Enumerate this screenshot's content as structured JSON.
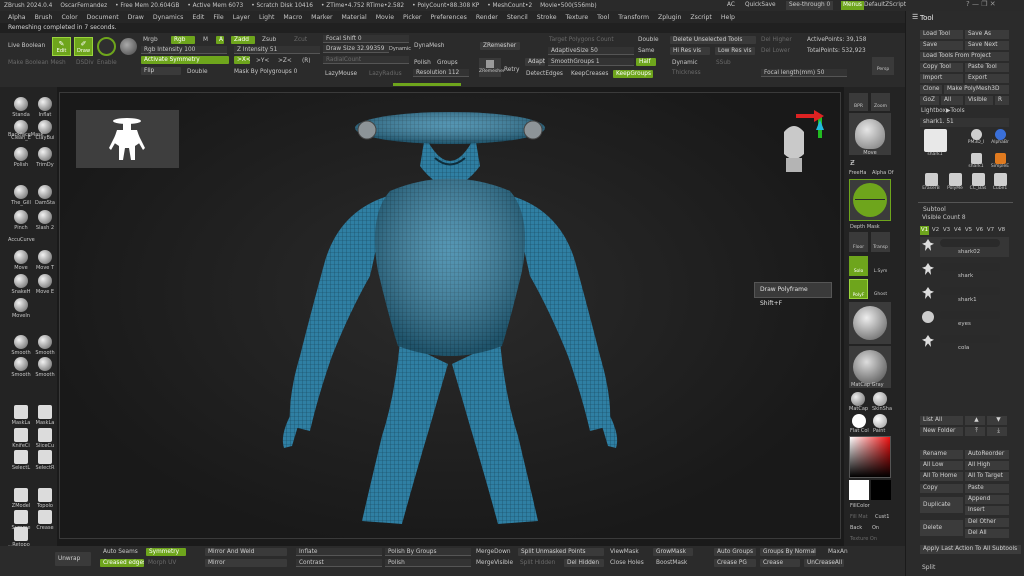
{
  "titlebar": {
    "app": "ZBrush 2024.0.4",
    "user": "OscarFernandez",
    "free_mem": "• Free Mem 20.604GB",
    "active_mem": "• Active Mem 6073",
    "scratch": "• Scratch Disk 10416",
    "ztime": "• ZTime•4.752 RTime•2.582",
    "polycount": "• PolyCount•88.308 KP",
    "meshcount": "• MeshCount•2",
    "movie": "Movie•500(556mb)",
    "ac": "AC",
    "quicksave": "QuickSave",
    "seethrough": "See-through",
    "seethrough_val": "0",
    "menus": "Menus",
    "script": "DefaultZScript"
  },
  "menu": [
    "Alpha",
    "Brush",
    "Color",
    "Document",
    "Draw",
    "Dynamics",
    "Edit",
    "File",
    "Layer",
    "Light",
    "Macro",
    "Marker",
    "Material",
    "Movie",
    "Picker",
    "Preferences",
    "Render",
    "Stencil",
    "Stroke",
    "Texture",
    "Tool",
    "Transform",
    "Zplugin",
    "Zscript",
    "Help"
  ],
  "notice": "Remeshing completed in 7 seconds.",
  "top": {
    "live_boolean": "Live Boolean",
    "make_boolean_mesh": "Make Boolean Mesh",
    "dsdiv": "DSDiv",
    "enable": "Enable",
    "edit": "Edit",
    "draw": "Draw",
    "mrgb": "Mrgb",
    "rgb": "Rgb",
    "m": "M",
    "zadd": "Zadd",
    "zsub": "Zsub",
    "zcut": "Zcut",
    "a": "A",
    "rgb_intensity": "Rgb Intensity 100",
    "z_intensity": "Z Intensity 51",
    "activate_symmetry": "Activate Symmetry",
    "x_axis": ">X<",
    "y_axis": ">Y<",
    "z_axis": ">Z<",
    "r": "(R)",
    "flip": "Flip",
    "double": "Double",
    "mask_by_polygroups": "Mask By Polygroups 0",
    "focal_shift": "Focal Shift 0",
    "draw_size": "Draw Size 32.99359",
    "dynamic": "Dynamic",
    "radial_count": "RadialCount",
    "lazymouse": "LazyMouse",
    "lazyradius": "LazyRadius",
    "dynamesh": "DynaMesh",
    "polish": "Polish",
    "groups": "Groups",
    "resolution": "Resolution 112",
    "zremesher": "ZRemesher",
    "zremesher_icon": "ZRemesher",
    "retry": "Retry",
    "target_polygons": "Target Polygons Count",
    "adaptive": "Adapt",
    "adaptive_size": "AdaptiveSize 50",
    "smooth_groups": "SmoothGroups 1",
    "detect_edges": "DetectEdges",
    "keep_creases": "KeepCreases",
    "keep_groups": "KeepGroups",
    "double2": "Double",
    "same": "Same",
    "half": "Half",
    "delete_unselected": "Delete Unselected Tools",
    "hi_res_vis": "Hi Res vis",
    "low_res_vis": "Low Res vis",
    "dynamic2": "Dynamic",
    "thickness": "Thickness",
    "del_higher": "Del Higher",
    "del_lower": "Del Lower",
    "active_points": "ActivePoints: 39,158",
    "total_points": "TotalPoints: 532,923",
    "smooth_subdiv": "SSub",
    "focal_length": "Focal length(mm) 50",
    "persp": "Persp"
  },
  "left": {
    "standard": "Standa",
    "inflat": "Inflat",
    "clean": "Clean_E",
    "claybuild": "ClayBui",
    "backface": "BackfaceMask",
    "polish": "Polish",
    "trimdy": "TrimDy",
    "gill": "The_Gill",
    "damstd": "DamSta",
    "pinch": "Pinch",
    "slash": "Slash 2",
    "accucurve": "AccuCurve",
    "move": "Move",
    "movet": "Move T",
    "snakeh": "SnakeH",
    "movee": "Move E",
    "movein": "MoveIn",
    "smooth1": "Smooth",
    "smooth2": "Smooth",
    "smooth3": "Smooth",
    "smooth4": "Smooth",
    "masklasso": "MaskLa",
    "masklasso2": "MaskLa",
    "knife": "KnifeCi",
    "slicecurve": "SliceCu",
    "selectlasso": "SelectL",
    "selectrect": "SelectR",
    "zmodel": "ZModel",
    "topology": "Topolo",
    "symmetry": "Symme",
    "crease": "Crease",
    "retopo": "Retopo",
    "flatten": "Flatten",
    "uvflatten": "UVFlatten"
  },
  "right": {
    "bpr": "BPR",
    "zoom": "Zoom",
    "move": "Move",
    "freehand": "FreeHa",
    "alpha": "Alpha Of",
    "depth_mask": "Depth Mask",
    "floor": "Floor",
    "transp": "Transp",
    "solo": "Solo",
    "lsym": "L.Sym",
    "dynamic": "Dynamic",
    "ghost": "Ghost",
    "polyf": "PolyF",
    "matcap_gray": "MatCap Gray",
    "matcap": "MatCap",
    "skinshade": "SkinSha",
    "flat_color": "Flat Col",
    "paint": "Paint",
    "fill_color": "FillColor",
    "fill_mat": "Fill Mat",
    "cust": "Cust1",
    "back": "Back",
    "on": "On",
    "texture_on": "Texture On"
  },
  "tooltip": "Draw Polyframe Shift+F",
  "panel": {
    "title": "Tool",
    "load_tool": "Load Tool",
    "save_as": "Save As",
    "save": "Save",
    "save_next": "Save Next",
    "load_tools_from_project": "Load Tools From Project",
    "copy_tool": "Copy Tool",
    "paste_tool": "Paste Tool",
    "import": "Import",
    "export": "Export",
    "clone": "Clone",
    "make_polymesh": "Make PolyMesh3D",
    "goz": "GoZ",
    "all": "All",
    "visible": "Visible",
    "r": "R",
    "lightbox_tools": "Lightbox▶Tools",
    "shark_count": "shark1. 51",
    "tools": [
      {
        "label": "shark1"
      },
      {
        "label": "PM3D_I"
      },
      {
        "label": "AlphaBr"
      },
      {
        "label": "shark1"
      },
      {
        "label": "SimpleE"
      },
      {
        "label": "EraserB"
      },
      {
        "label": "PolyMe"
      },
      {
        "label": "CC_Bas"
      },
      {
        "label": "Cube1"
      },
      {
        "label": "shark1"
      }
    ],
    "subtool": "Subtool",
    "visible_count": "Visible Count 8",
    "versions": [
      "V1",
      "V2",
      "V3",
      "V4",
      "V5",
      "V6",
      "V7",
      "V8"
    ],
    "subtools": [
      "shark02",
      "shark",
      "shark1",
      "eyes",
      "cola"
    ],
    "list_all": "List All",
    "new_folder": "New Folder",
    "rename": "Rename",
    "auto_reorder": "AutoReorder",
    "all_low": "All Low",
    "all_high": "All High",
    "all_to_home": "All To Home",
    "all_to_target": "All To Target",
    "copy": "Copy",
    "paste": "Paste",
    "duplicate": "Duplicate",
    "append": "Append",
    "insert": "Insert",
    "delete": "Delete",
    "del_other": "Del Other",
    "del_all": "Del All",
    "apply_last": "Apply Last Action To All Subtools",
    "split": "Split"
  },
  "bottom": {
    "unwrap": "Unwrap",
    "auto_seams": "Auto Seams",
    "symmetry": "Symmetry",
    "creased_edges": "Creased edges",
    "morph_uv": "Morph UV",
    "mirror_and_weld": "Mirror And Weld",
    "mirror": "Mirror",
    "inflate": "Inflate",
    "contrast": "Contrast",
    "polish_by_groups": "Polish By Groups",
    "polish": "Polish",
    "merge_down": "MergeDown",
    "merge_visible": "MergeVisible",
    "split_unmasked": "Split Unmasked Points",
    "split_hidden": "Split Hidden",
    "del_hidden": "Del Hidden",
    "view_mask": "ViewMask",
    "close_holes": "Close Holes",
    "grow_mask": "GrowMask",
    "boost_mask": "BoostMask",
    "auto_groups": "Auto Groups",
    "crease_pg": "Crease PG",
    "groups_by_normals": "Groups By Normals",
    "crease": "Crease",
    "max_angle": "MaxAn",
    "uncrease_all": "UnCreaseAll"
  }
}
